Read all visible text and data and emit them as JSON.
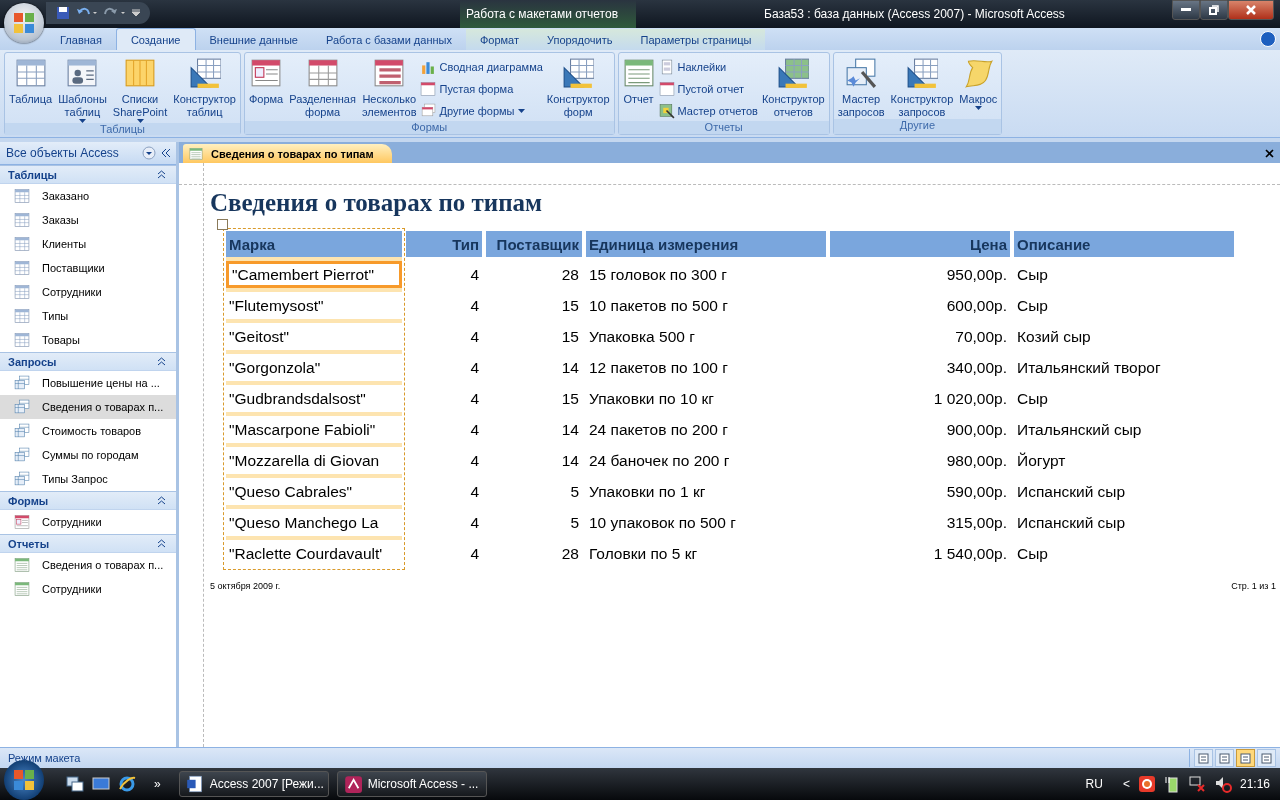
{
  "title_bar": {
    "contextual_tab": "Работа с макетами отчетов",
    "title": "База53 : база данных (Access 2007)  -  Microsoft Access"
  },
  "ribbon_tabs": [
    {
      "label": "Главная",
      "selected": false,
      "contextual": false
    },
    {
      "label": "Создание",
      "selected": true,
      "contextual": false
    },
    {
      "label": "Внешние данные",
      "selected": false,
      "contextual": false
    },
    {
      "label": "Работа с базами данных",
      "selected": false,
      "contextual": false
    },
    {
      "label": "Формат",
      "selected": false,
      "contextual": true
    },
    {
      "label": "Упорядочить",
      "selected": false,
      "contextual": true
    },
    {
      "label": "Параметры страницы",
      "selected": false,
      "contextual": true
    }
  ],
  "ribbon_groups": [
    {
      "label": "Таблицы",
      "items": [
        {
          "kind": "large",
          "lines": [
            "Таблица"
          ],
          "dropdown": false
        },
        {
          "kind": "large",
          "lines": [
            "Шаблоны",
            "таблиц"
          ],
          "dropdown": true
        },
        {
          "kind": "large",
          "lines": [
            "Списки",
            "SharePoint"
          ],
          "dropdown": true
        },
        {
          "kind": "large",
          "lines": [
            "Конструктор",
            "таблиц"
          ],
          "dropdown": false
        }
      ]
    },
    {
      "label": "Формы",
      "items": [
        {
          "kind": "large",
          "lines": [
            "Форма"
          ],
          "dropdown": false
        },
        {
          "kind": "large",
          "lines": [
            "Разделенная",
            "форма"
          ],
          "dropdown": false
        },
        {
          "kind": "large",
          "lines": [
            "Несколько",
            "элементов"
          ],
          "dropdown": false
        },
        {
          "kind": "small",
          "lines": [
            "Сводная диаграмма"
          ],
          "dropdown": false
        },
        {
          "kind": "small",
          "lines": [
            "Пустая форма"
          ],
          "dropdown": false
        },
        {
          "kind": "small",
          "lines": [
            "Другие формы"
          ],
          "dropdown": true
        },
        {
          "kind": "large",
          "lines": [
            "Конструктор",
            "форм"
          ],
          "dropdown": false
        }
      ]
    },
    {
      "label": "Отчеты",
      "items": [
        {
          "kind": "large",
          "lines": [
            "Отчет"
          ],
          "dropdown": false
        },
        {
          "kind": "small",
          "lines": [
            "Наклейки"
          ],
          "dropdown": false
        },
        {
          "kind": "small",
          "lines": [
            "Пустой отчет"
          ],
          "dropdown": false
        },
        {
          "kind": "small",
          "lines": [
            "Мастер отчетов"
          ],
          "dropdown": false
        },
        {
          "kind": "large",
          "lines": [
            "Конструктор",
            "отчетов"
          ],
          "dropdown": false
        }
      ]
    },
    {
      "label": "Другие",
      "items": [
        {
          "kind": "large",
          "lines": [
            "Мастер",
            "запросов"
          ],
          "dropdown": false
        },
        {
          "kind": "large",
          "lines": [
            "Конструктор",
            "запросов"
          ],
          "dropdown": false
        },
        {
          "kind": "large",
          "lines": [
            "Макрос"
          ],
          "dropdown": true
        }
      ]
    }
  ],
  "nav_pane": {
    "title": "Все объекты Access",
    "groups": [
      {
        "label": "Таблицы",
        "items": [
          {
            "label": "Заказано",
            "selected": false
          },
          {
            "label": "Заказы",
            "selected": false
          },
          {
            "label": "Клиенты",
            "selected": false
          },
          {
            "label": "Поставщики",
            "selected": false
          },
          {
            "label": "Сотрудники",
            "selected": false
          },
          {
            "label": "Типы",
            "selected": false
          },
          {
            "label": "Товары",
            "selected": false
          }
        ]
      },
      {
        "label": "Запросы",
        "items": [
          {
            "label": "Повышение цены на ...",
            "selected": false
          },
          {
            "label": "Сведения о товарах п...",
            "selected": true
          },
          {
            "label": "Стоимость товаров",
            "selected": false
          },
          {
            "label": "Суммы по городам",
            "selected": false
          },
          {
            "label": "Типы Запрос",
            "selected": false
          }
        ]
      },
      {
        "label": "Формы",
        "items": [
          {
            "label": "Сотрудники",
            "selected": false
          }
        ]
      },
      {
        "label": "Отчеты",
        "items": [
          {
            "label": "Сведения о товарах п...",
            "selected": false
          },
          {
            "label": "Сотрудники",
            "selected": false
          }
        ]
      }
    ]
  },
  "document_tab": {
    "label": "Сведения о товарах по типам"
  },
  "report": {
    "title": "Сведения о товарах по типам",
    "columns": [
      "Марка",
      "Тип",
      "Поставщик",
      "Единица измерения",
      "Цена",
      "Описание"
    ],
    "rows": [
      {
        "selected": true,
        "cells": [
          "\"Camembert Pierrot\"",
          "4",
          "28",
          "15 головок по 300 г",
          "950,00р.",
          "Сыр"
        ]
      },
      {
        "selected": false,
        "cells": [
          "\"Flutemysost\"",
          "4",
          "15",
          "10 пакетов по 500 г",
          "600,00р.",
          "Сыр"
        ]
      },
      {
        "selected": false,
        "cells": [
          "\"Geitost\"",
          "4",
          "15",
          "Упаковка 500 г",
          "70,00р.",
          "Козий сыр"
        ]
      },
      {
        "selected": false,
        "cells": [
          "\"Gorgonzola\"",
          "4",
          "14",
          "12 пакетов по 100 г",
          "340,00р.",
          "Итальянский творог"
        ]
      },
      {
        "selected": false,
        "cells": [
          "\"Gudbrandsdalsost\"",
          "4",
          "15",
          "Упаковки по 10 кг",
          "1 020,00р.",
          "Сыр"
        ]
      },
      {
        "selected": false,
        "cells": [
          "\"Mascarpone Fabioli\"",
          "4",
          "14",
          "24 пакетов по 200 г",
          "900,00р.",
          "Итальянский сыр"
        ]
      },
      {
        "selected": false,
        "cells": [
          "\"Mozzarella di Giovan",
          "4",
          "14",
          "24 баночек по 200 г",
          "980,00р.",
          "Йогурт"
        ]
      },
      {
        "selected": false,
        "cells": [
          "\"Queso Cabrales\"",
          "4",
          "5",
          "Упаковки по 1 кг",
          "590,00р.",
          "Испанский сыр"
        ]
      },
      {
        "selected": false,
        "cells": [
          "\"Queso Manchego La",
          "4",
          "5",
          "10 упаковок по 500 г",
          "315,00р.",
          "Испанский сыр"
        ]
      },
      {
        "selected": false,
        "cells": [
          "\"Raclette Courdavault'",
          "4",
          "28",
          "Головки по 5 кг",
          "1 540,00р.",
          "Сыр"
        ]
      }
    ],
    "date": "5 октября 2009 г.",
    "page": "Стр. 1 из 1"
  },
  "status_bar": {
    "text": "Режим макета",
    "views": [
      {
        "selected": false
      },
      {
        "selected": false
      },
      {
        "selected": true
      },
      {
        "selected": false
      }
    ]
  },
  "taskbar": {
    "more": "»",
    "buttons": [
      {
        "label": "Access 2007 [Режи..."
      },
      {
        "label": "Microsoft Access - ..."
      }
    ],
    "language": "RU",
    "tray_toggle": "<",
    "clock": "21:16"
  }
}
